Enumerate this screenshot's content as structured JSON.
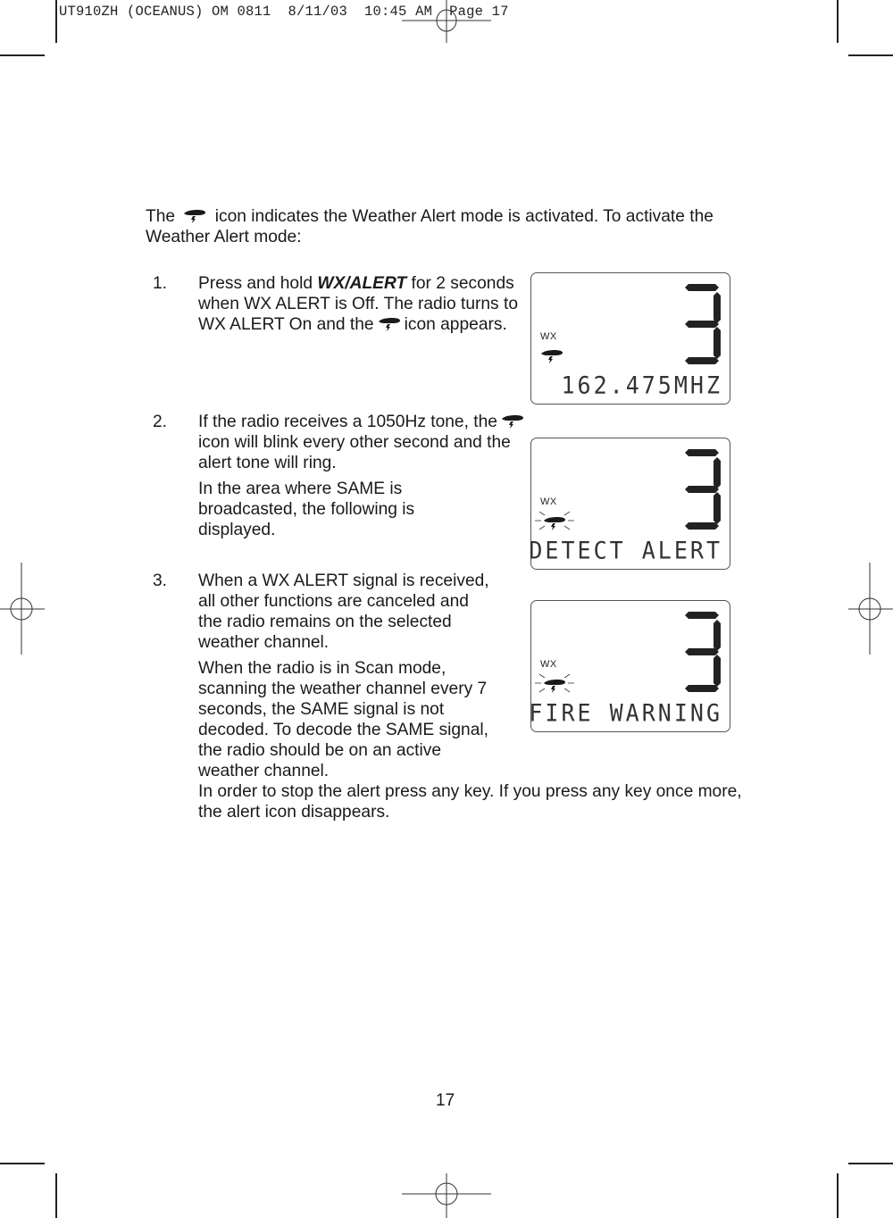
{
  "print_slug": "UT910ZH (OCEANUS) OM 0811  8/11/03  10:45 AM  Page 17",
  "intro": {
    "before_icon": "The",
    "icon": "weather-alert-icon",
    "after_icon": "icon indicates the Weather Alert mode is activated.  To activate the Weather Alert mode:"
  },
  "steps": [
    {
      "number": "1.",
      "paragraphs": [
        {
          "pre": "Press and hold ",
          "key": "WX/ALERT",
          "post": " for 2 seconds when WX ALERT is Off. The radio turns to WX ALERT On and the",
          "icon": "weather-alert-icon",
          "tail": "icon appears."
        }
      ]
    },
    {
      "number": "2.",
      "paragraphs": [
        {
          "pre": "If the radio receives a 1050Hz tone, the",
          "icon": "weather-alert-icon",
          "tail": "icon will blink every other second and the alert tone will ring."
        },
        {
          "text": "In the area where SAME is broadcasted, the following is displayed."
        }
      ]
    },
    {
      "number": "3.",
      "paragraphs": [
        {
          "text": "When a WX ALERT signal is received, all other functions are canceled and the radio remains on the selected weather channel."
        },
        {
          "text": "When the radio is in Scan mode, scanning the weather channel every 7 seconds, the SAME signal is not decoded.  To decode the SAME signal, the radio should be on an active weather channel."
        }
      ]
    }
  ],
  "closing_text": "In order to stop the alert press any key.  If you press any key once more, the alert icon disappears.",
  "lcd_displays": [
    {
      "wx_label": "WX",
      "channel_digit": "3",
      "icon": "weather-alert-icon",
      "blinking": false,
      "text": "162.475MHZ"
    },
    {
      "wx_label": "WX",
      "channel_digit": "3",
      "icon": "weather-alert-icon",
      "blinking": true,
      "text": "DETECT ALERT"
    },
    {
      "wx_label": "WX",
      "channel_digit": "3",
      "icon": "weather-alert-icon",
      "blinking": true,
      "text": "FIRE WARNING"
    }
  ],
  "page_number": "17"
}
